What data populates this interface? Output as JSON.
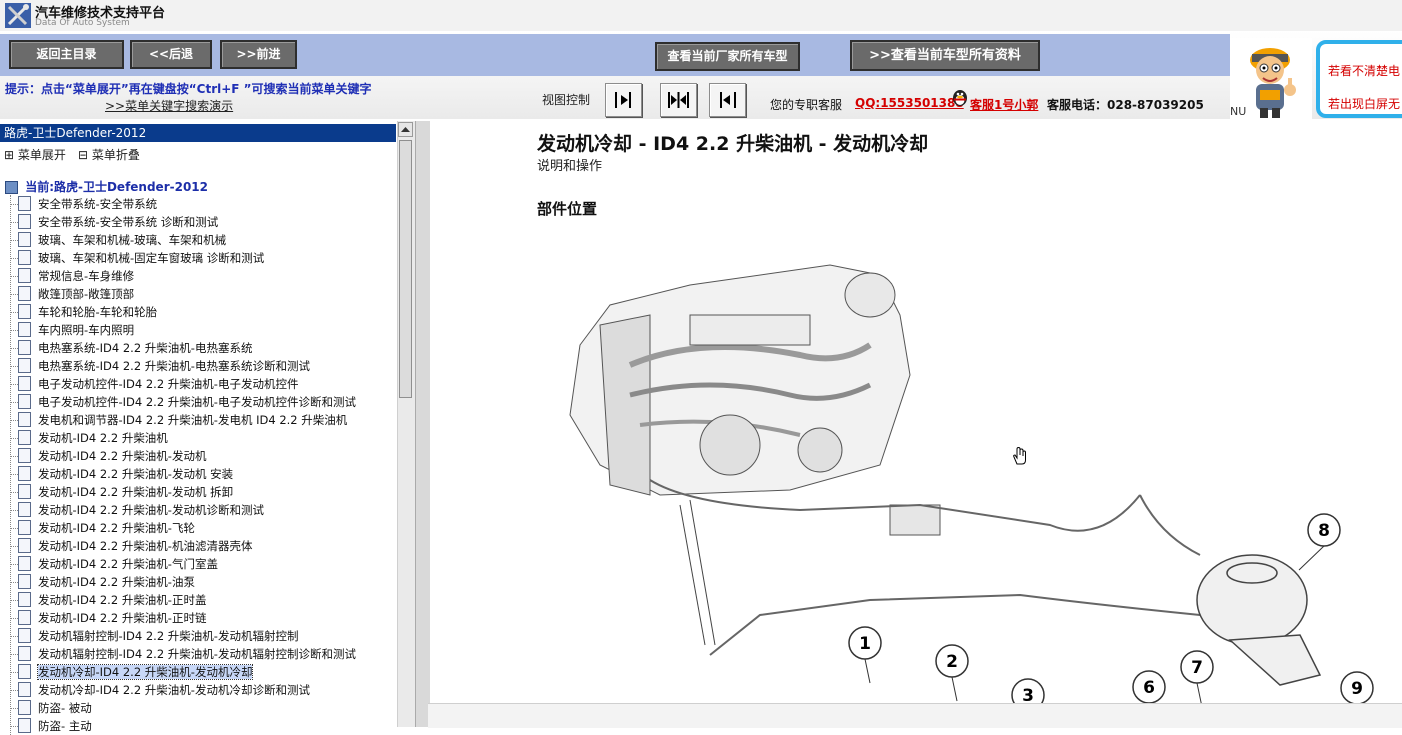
{
  "app": {
    "title": "汽车维修技术支持平台",
    "subtitle": "Data Of Auto System"
  },
  "toolbar": {
    "home_label": "返回主目录",
    "back_label": "<<后退",
    "forward_label": ">>前进",
    "all_models_label": "查看当前厂家所有车型",
    "all_docs_label": ">>查看当前车型所有资料",
    "tip": "提示：点击“菜单展开”再在键盘按“Ctrl+F ”可搜索当前菜单关键字",
    "demo_link": ">>菜单关键字搜索演示",
    "view_control_label": "视图控制",
    "service_text": "您的专职客服",
    "qq": "QQ:1553501388",
    "cs_link": "客服1号小郭",
    "phone": "客服电话：028-87039205",
    "notice_1": "若看不清楚电",
    "notice_2": "若出现白屏无",
    "nu": "NU"
  },
  "sidebar": {
    "header": "路虎-卫士Defender-2012",
    "expand_label": "菜单展开",
    "collapse_label": "菜单折叠",
    "current": "当前:路虎-卫士Defender-2012",
    "items": [
      "安全带系统-安全带系统",
      "安全带系统-安全带系统 诊断和测试",
      "玻璃、车架和机械-玻璃、车架和机械",
      "玻璃、车架和机械-固定车窗玻璃 诊断和测试",
      "常规信息-车身维修",
      "敞篷顶部-敞篷顶部",
      "车轮和轮胎-车轮和轮胎",
      "车内照明-车内照明",
      "电热塞系统-ID4 2.2 升柴油机-电热塞系统",
      "电热塞系统-ID4 2.2 升柴油机-电热塞系统诊断和测试",
      "电子发动机控件-ID4 2.2 升柴油机-电子发动机控件",
      "电子发动机控件-ID4 2.2 升柴油机-电子发动机控件诊断和测试",
      "发电机和调节器-ID4 2.2 升柴油机-发电机  ID4 2.2 升柴油机",
      "发动机-ID4 2.2 升柴油机",
      "发动机-ID4 2.2 升柴油机-发动机",
      "发动机-ID4 2.2 升柴油机-发动机 安装",
      "发动机-ID4 2.2 升柴油机-发动机 拆卸",
      "发动机-ID4 2.2 升柴油机-发动机诊断和测试",
      "发动机-ID4 2.2 升柴油机-飞轮",
      "发动机-ID4 2.2 升柴油机-机油滤清器壳体",
      "发动机-ID4 2.2 升柴油机-气门室盖",
      "发动机-ID4 2.2 升柴油机-油泵",
      "发动机-ID4 2.2 升柴油机-正时盖",
      "发动机-ID4 2.2 升柴油机-正时链",
      "发动机辐射控制-ID4 2.2 升柴油机-发动机辐射控制",
      "发动机辐射控制-ID4 2.2 升柴油机-发动机辐射控制诊断和测试",
      "发动机冷却-ID4 2.2 升柴油机-发动机冷却",
      "发动机冷却-ID4 2.2 升柴油机-发动机冷却诊断和测试",
      "防盗- 被动",
      "防盗- 主动"
    ]
  },
  "document": {
    "title": "发动机冷却 - ID4 2.2 升柴油机 - 发动机冷却",
    "subtitle": "说明和操作",
    "section": "部件位置",
    "callouts": [
      "1",
      "2",
      "3",
      "6",
      "7",
      "8",
      "9"
    ]
  },
  "colors": {
    "tree_header_bg": "#0a3b8c",
    "link_red": "#d40000",
    "tip_blue": "#1f2fb5",
    "toolbar_blue": "#a8b9e2",
    "notice_border": "#2fb0ea"
  }
}
